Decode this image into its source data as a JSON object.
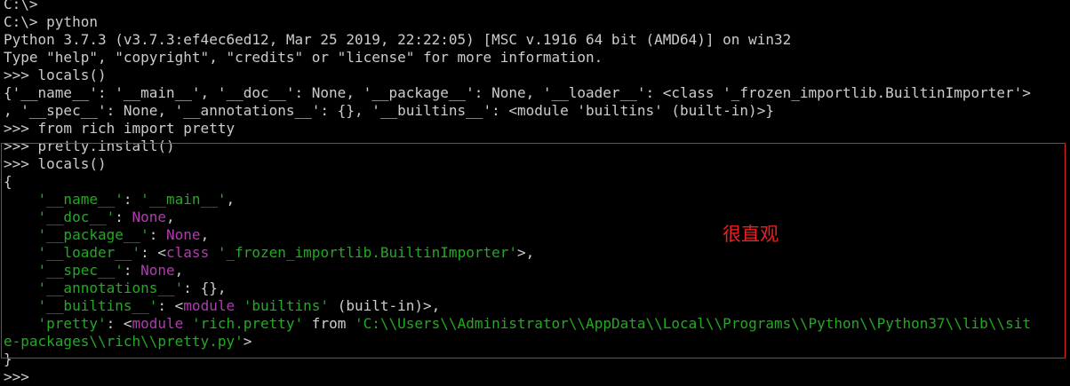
{
  "terminal": {
    "lines": [
      [
        {
          "t": "C:\\>",
          "c": "plain"
        }
      ],
      [
        {
          "t": "C:\\> python",
          "c": "plain"
        }
      ],
      [
        {
          "t": "Python 3.7.3 (v3.7.3:ef4ec6ed12, Mar 25 2019, 22:22:05) [MSC v.1916 64 bit (AMD64)] on win32",
          "c": "plain"
        }
      ],
      [
        {
          "t": "Type \"help\", \"copyright\", \"credits\" or \"license\" for more information.",
          "c": "plain"
        }
      ],
      [
        {
          "t": ">>> locals()",
          "c": "plain"
        }
      ],
      [
        {
          "t": "{'__name__': '__main__', '__doc__': None, '__package__': None, '__loader__': <class '_frozen_importlib.BuiltinImporter'>",
          "c": "plain"
        }
      ],
      [
        {
          "t": ", '__spec__': None, '__annotations__': {}, '__builtins__': <module 'builtins' (built-in)>}",
          "c": "plain"
        }
      ],
      [
        {
          "t": ">>> from rich import pretty",
          "c": "plain"
        }
      ],
      [
        {
          "t": ">>> pretty.install()",
          "c": "plain"
        }
      ],
      [
        {
          "t": ">>> locals()",
          "c": "plain"
        }
      ],
      [
        {
          "t": "{",
          "c": "plain"
        }
      ],
      [
        {
          "t": "    ",
          "c": "plain"
        },
        {
          "t": "'__name__'",
          "c": "green"
        },
        {
          "t": ": ",
          "c": "plain"
        },
        {
          "t": "'__main__'",
          "c": "green"
        },
        {
          "t": ",",
          "c": "plain"
        }
      ],
      [
        {
          "t": "    ",
          "c": "plain"
        },
        {
          "t": "'__doc__'",
          "c": "green"
        },
        {
          "t": ": ",
          "c": "plain"
        },
        {
          "t": "None",
          "c": "purple"
        },
        {
          "t": ",",
          "c": "plain"
        }
      ],
      [
        {
          "t": "    ",
          "c": "plain"
        },
        {
          "t": "'__package__'",
          "c": "green"
        },
        {
          "t": ": ",
          "c": "plain"
        },
        {
          "t": "None",
          "c": "purple"
        },
        {
          "t": ",",
          "c": "plain"
        }
      ],
      [
        {
          "t": "    ",
          "c": "plain"
        },
        {
          "t": "'__loader__'",
          "c": "green"
        },
        {
          "t": ": <",
          "c": "plain"
        },
        {
          "t": "class",
          "c": "purple"
        },
        {
          "t": " ",
          "c": "plain"
        },
        {
          "t": "'_frozen_importlib.BuiltinImporter'",
          "c": "green"
        },
        {
          "t": ">,",
          "c": "plain"
        }
      ],
      [
        {
          "t": "    ",
          "c": "plain"
        },
        {
          "t": "'__spec__'",
          "c": "green"
        },
        {
          "t": ": ",
          "c": "plain"
        },
        {
          "t": "None",
          "c": "purple"
        },
        {
          "t": ",",
          "c": "plain"
        }
      ],
      [
        {
          "t": "    ",
          "c": "plain"
        },
        {
          "t": "'__annotations__'",
          "c": "green"
        },
        {
          "t": ": {},",
          "c": "plain"
        }
      ],
      [
        {
          "t": "    ",
          "c": "plain"
        },
        {
          "t": "'__builtins__'",
          "c": "green"
        },
        {
          "t": ": <",
          "c": "plain"
        },
        {
          "t": "module",
          "c": "purple"
        },
        {
          "t": " ",
          "c": "plain"
        },
        {
          "t": "'builtins'",
          "c": "green"
        },
        {
          "t": " (built-in)>,",
          "c": "plain"
        }
      ],
      [
        {
          "t": "    ",
          "c": "plain"
        },
        {
          "t": "'pretty'",
          "c": "green"
        },
        {
          "t": ": <",
          "c": "plain"
        },
        {
          "t": "module",
          "c": "purple"
        },
        {
          "t": " ",
          "c": "plain"
        },
        {
          "t": "'rich.pretty'",
          "c": "green"
        },
        {
          "t": " from ",
          "c": "plain"
        },
        {
          "t": "'C:\\\\Users\\\\Administrator\\\\AppData\\\\Local\\\\Programs\\\\Python\\\\Python37\\\\lib\\\\sit",
          "c": "green"
        }
      ],
      [
        {
          "t": "e-packages\\\\rich\\\\pretty.py'",
          "c": "green"
        },
        {
          "t": ">",
          "c": "plain"
        }
      ],
      [
        {
          "t": "}",
          "c": "plain"
        }
      ],
      [
        {
          "t": ">>>",
          "c": "plain"
        }
      ]
    ]
  },
  "annotation": {
    "text": "很直观"
  },
  "colors": {
    "background": "#000000",
    "text": "#cccccc",
    "string": "#22aa22",
    "keyword": "#b23ab2",
    "highlight_border": "#e02020",
    "annotation": "#e82020"
  }
}
